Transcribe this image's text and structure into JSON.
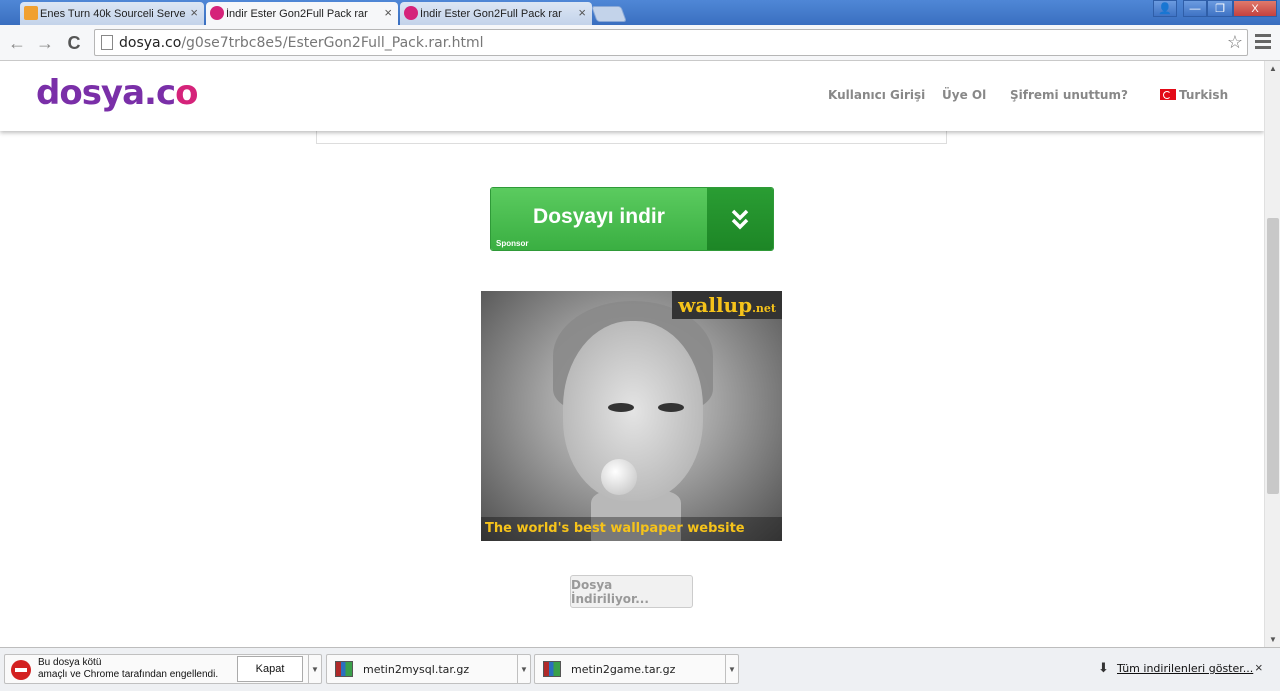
{
  "tabs": [
    {
      "label": "Enes Turn 40k Sourceli Serve",
      "close": "×",
      "active": false
    },
    {
      "label": "İndir Ester Gon2Full Pack rar",
      "close": "×",
      "active": true
    },
    {
      "label": "İndir Ester Gon2Full Pack rar",
      "close": "×",
      "active": false
    }
  ],
  "window": {
    "user": "👤",
    "minimize": "—",
    "restore": "❐",
    "close": "X"
  },
  "toolbar": {
    "back": "←",
    "forward": "→",
    "reload": "C",
    "url_host": "dosya.co",
    "url_path": "/g0se7trbc8e5/EsterGon2Full_Pack.rar.html",
    "star": "☆"
  },
  "site": {
    "logo_main": "dosya.c",
    "logo_end": "o",
    "nav": {
      "login": "Kullanıcı Girişi",
      "register": "Üye Ol",
      "forgot": "Şifremi unuttum?",
      "language": "Turkish"
    }
  },
  "download_button": {
    "label": "Dosyayı indir",
    "sponsor": "Sponsor"
  },
  "ad": {
    "brand": "wallup",
    "brand_suffix": ".net",
    "tagline": "The world's best wallpaper website"
  },
  "downloading_button": {
    "label": "Dosya İndiriliyor..."
  },
  "shelf": {
    "blocked_text_line1": "Bu dosya kötü",
    "blocked_text_line2": "amaçlı ve Chrome tarafından engellendi.",
    "kapat": "Kapat",
    "items": [
      {
        "filename": "metin2mysql.tar.gz"
      },
      {
        "filename": "metin2game.tar.gz"
      }
    ],
    "show_all": "Tüm indirilenleri göster...",
    "close": "×"
  },
  "colors": {
    "accent_green": "#3aaf42",
    "logo_purple": "#7a2fa8",
    "logo_pink": "#d5237a"
  }
}
